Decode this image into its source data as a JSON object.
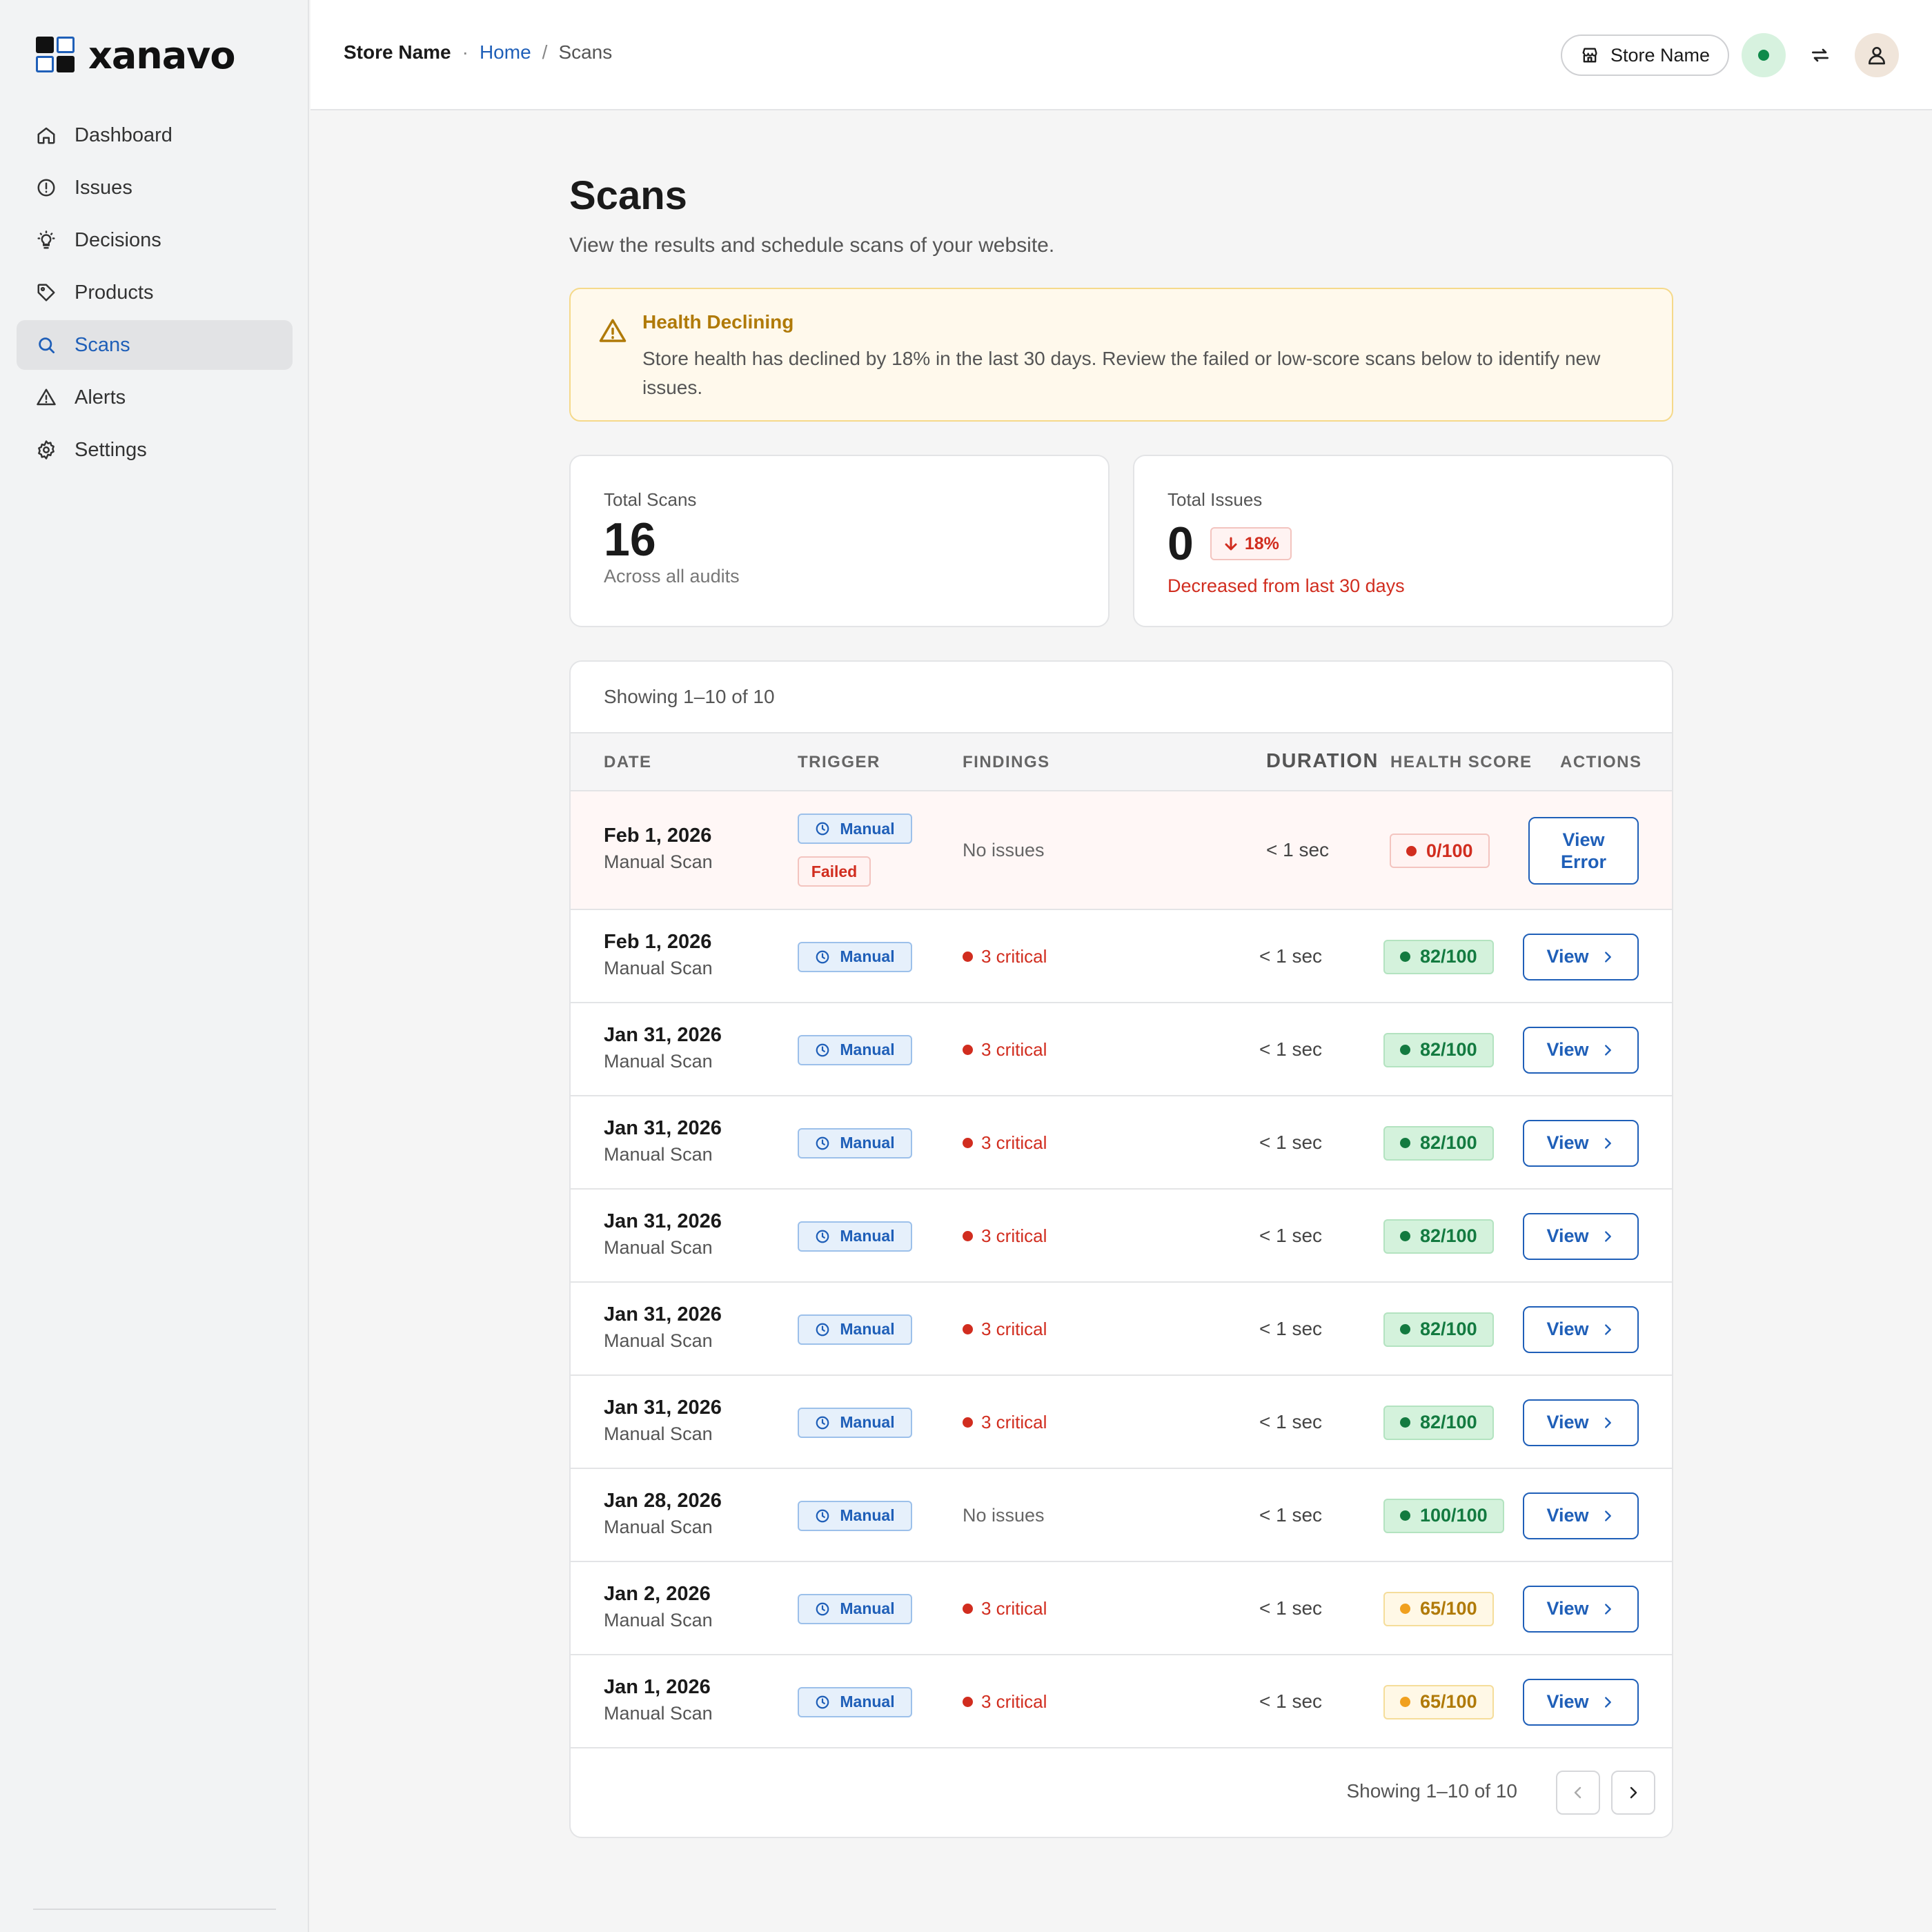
{
  "brand": {
    "name": "xanavo"
  },
  "sidebar": {
    "items": [
      {
        "label": "Dashboard",
        "icon": "home-icon",
        "active": false
      },
      {
        "label": "Issues",
        "icon": "alert-circle-icon",
        "active": false
      },
      {
        "label": "Decisions",
        "icon": "lightbulb-icon",
        "active": false
      },
      {
        "label": "Products",
        "icon": "tag-icon",
        "active": false
      },
      {
        "label": "Scans",
        "icon": "search-icon",
        "active": true
      },
      {
        "label": "Alerts",
        "icon": "warning-triangle-icon",
        "active": false
      },
      {
        "label": "Settings",
        "icon": "gear-icon",
        "active": false
      }
    ]
  },
  "header": {
    "store_name": "Store Name",
    "breadcrumb": {
      "home": "Home",
      "separator": "/",
      "current": "Scans"
    },
    "store_button": "Store Name"
  },
  "page": {
    "title": "Scans",
    "subtitle": "View the results and schedule scans of your website."
  },
  "alert": {
    "title": "Health Declining",
    "text": "Store health has declined by 18% in the last 30 days. Review the failed or low-score scans below to identify new issues."
  },
  "stats": {
    "total_scans": {
      "label": "Total Scans",
      "value": "16",
      "note": "Across all audits"
    },
    "total_issues": {
      "label": "Total Issues",
      "value": "0",
      "trend": "18%",
      "note": "Decreased from last 30 days"
    }
  },
  "table": {
    "summary": "Showing 1–10 of 10",
    "columns": {
      "date": "DATE",
      "trigger": "TRIGGER",
      "findings": "FINDINGS",
      "duration": "DURATION",
      "health_score": "HEALTH SCORE",
      "actions": "ACTIONS"
    },
    "rows": [
      {
        "date": "Feb 1, 2026",
        "type": "Manual Scan",
        "trigger": "Manual",
        "status": "Failed",
        "findings": "No issues",
        "duration": "< 1 sec",
        "score": "0/100",
        "score_level": "red",
        "action": "View Error"
      },
      {
        "date": "Feb 1, 2026",
        "type": "Manual Scan",
        "trigger": "Manual",
        "findings": "3 critical",
        "duration": "< 1 sec",
        "score": "82/100",
        "score_level": "green",
        "action": "View"
      },
      {
        "date": "Jan 31, 2026",
        "type": "Manual Scan",
        "trigger": "Manual",
        "findings": "3 critical",
        "duration": "< 1 sec",
        "score": "82/100",
        "score_level": "green",
        "action": "View"
      },
      {
        "date": "Jan 31, 2026",
        "type": "Manual Scan",
        "trigger": "Manual",
        "findings": "3 critical",
        "duration": "< 1 sec",
        "score": "82/100",
        "score_level": "green",
        "action": "View"
      },
      {
        "date": "Jan 31, 2026",
        "type": "Manual Scan",
        "trigger": "Manual",
        "findings": "3 critical",
        "duration": "< 1 sec",
        "score": "82/100",
        "score_level": "green",
        "action": "View"
      },
      {
        "date": "Jan 31, 2026",
        "type": "Manual Scan",
        "trigger": "Manual",
        "findings": "3 critical",
        "duration": "< 1 sec",
        "score": "82/100",
        "score_level": "green",
        "action": "View"
      },
      {
        "date": "Jan 31, 2026",
        "type": "Manual Scan",
        "trigger": "Manual",
        "findings": "3 critical",
        "duration": "< 1 sec",
        "score": "82/100",
        "score_level": "green",
        "action": "View"
      },
      {
        "date": "Jan 28, 2026",
        "type": "Manual Scan",
        "trigger": "Manual",
        "findings": "No issues",
        "duration": "< 1 sec",
        "score": "100/100",
        "score_level": "green",
        "action": "View"
      },
      {
        "date": "Jan 2, 2026",
        "type": "Manual Scan",
        "trigger": "Manual",
        "findings": "3 critical",
        "duration": "< 1 sec",
        "score": "65/100",
        "score_level": "amber",
        "action": "View"
      },
      {
        "date": "Jan 1, 2026",
        "type": "Manual Scan",
        "trigger": "Manual",
        "findings": "3 critical",
        "duration": "< 1 sec",
        "score": "65/100",
        "score_level": "amber",
        "action": "View"
      }
    ],
    "footer": "Showing 1–10 of 10"
  },
  "colors": {
    "accent": "#1f5fb8",
    "danger": "#d12d1f",
    "success": "#137a40",
    "warning": "#b07a08"
  }
}
